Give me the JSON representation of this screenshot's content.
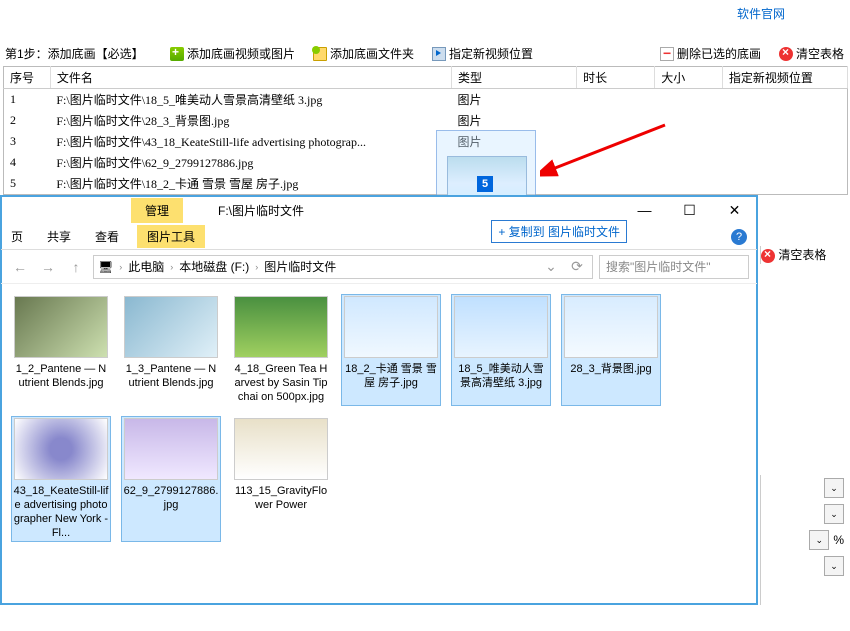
{
  "top_link": "软件官网",
  "step_label": "第1步：添加底画【必选】",
  "toolbar": {
    "add_media": "添加底画视频或图片",
    "add_folder": "添加底画文件夹",
    "set_video_pos": "指定新视频位置",
    "delete_selected": "删除已选的底画",
    "clear_table": "清空表格"
  },
  "table": {
    "headers": {
      "idx": "序号",
      "name": "文件名",
      "type": "类型",
      "dur": "时长",
      "size": "大小",
      "pos": "指定新视频位置"
    },
    "rows": [
      {
        "idx": "1",
        "name": "F:\\图片临时文件\\18_5_唯美动人雪景高清壁纸 3.jpg",
        "type": "图片"
      },
      {
        "idx": "2",
        "name": "F:\\图片临时文件\\28_3_背景图.jpg",
        "type": "图片"
      },
      {
        "idx": "3",
        "name": "F:\\图片临时文件\\43_18_KeateStill-life advertising photograp...",
        "type": "图片"
      },
      {
        "idx": "4",
        "name": "F:\\图片临时文件\\62_9_2799127886.jpg",
        "type": "图片"
      },
      {
        "idx": "5",
        "name": "F:\\图片临时文件\\18_2_卡通 雪景 雪屋 房子.jpg",
        "type": "图片"
      }
    ]
  },
  "drag_count": "5",
  "copy_hint": "+ 复制到 图片临时文件",
  "explorer": {
    "manage_tab": "管理",
    "tool_tab": "图片工具",
    "path_title": "F:\\图片临时文件",
    "menu": {
      "view": "页",
      "share": "共享",
      "look": "查看"
    },
    "breadcrumbs": [
      "此电脑",
      "本地磁盘 (F:)",
      "图片临时文件"
    ],
    "search_placeholder": "搜索\"图片临时文件\"",
    "files": [
      {
        "name": "1_2_Pantene — Nutrient Blends.jpg",
        "sel": false,
        "t": "t1"
      },
      {
        "name": "1_3_Pantene — Nutrient Blends.jpg",
        "sel": false,
        "t": "t2"
      },
      {
        "name": "4_18_Green Tea Harvest by Sasin Tipchai on 500px.jpg",
        "sel": false,
        "t": "t3"
      },
      {
        "name": "18_2_卡通 雪景 雪屋 房子.jpg",
        "sel": true,
        "t": "t4"
      },
      {
        "name": "18_5_唯美动人雪景高清壁纸 3.jpg",
        "sel": true,
        "t": "t5"
      },
      {
        "name": "28_3_背景图.jpg",
        "sel": true,
        "t": "t6"
      },
      {
        "name": "43_18_KeateStill-life advertising photographer New York - Fl...",
        "sel": true,
        "t": "t7"
      },
      {
        "name": "62_9_2799127886.jpg",
        "sel": true,
        "t": "t8"
      },
      {
        "name": "113_15_GravityFlower Power",
        "sel": false,
        "t": "t9"
      }
    ]
  },
  "right_clear": "清空表格",
  "right_pct": "%"
}
